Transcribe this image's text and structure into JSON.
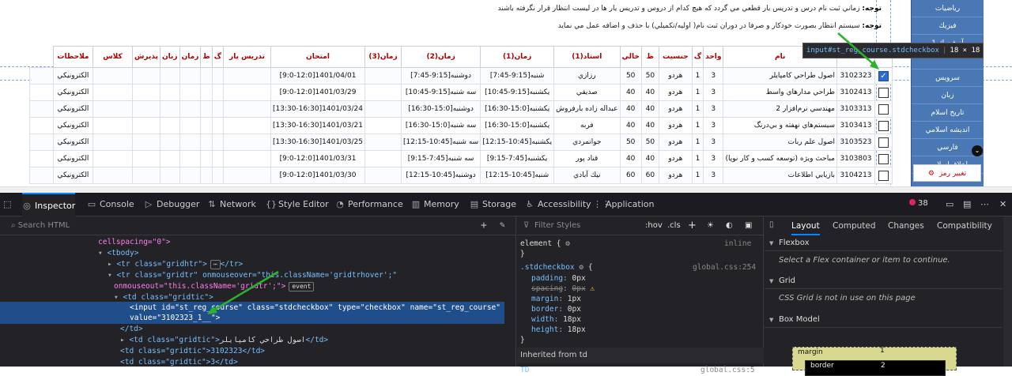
{
  "notes": {
    "note1_label": "توجه:",
    "note1_text": "زماني ثبت نام درس و تدريس يار قطعي مي گردد كه هيچ كدام از دروس و تدريس يار ها در ليست انتظار قرار نگرفته باشند",
    "note2_label": "توجه:",
    "note2_text": "سيستم انتظار بصورت خودكار و صرفا در دوران ثبت نام( اوليه/تكميلي) با حذف و اضافه عمل مي نمايد"
  },
  "sidebar": {
    "items": [
      "رياضيات",
      "فيزيك",
      "آز فيزيك 1",
      "",
      "سرويس",
      "زبان",
      "تاريخ اسلام",
      "انديشه اسلامي",
      "فارسي",
      "اخلاق اسلامي"
    ],
    "password_label": "تغيير رمز",
    "colors": {
      "bg": "#4a78b4"
    }
  },
  "tooltip": {
    "tag": "input",
    "selector": "#st_reg_course.stdcheckbox",
    "dims": "18 × 18"
  },
  "table": {
    "headers": [
      "",
      "كد",
      "نام",
      "واحد",
      "گ",
      "جنسيت",
      "ظ",
      "خالي",
      "استاد(1)",
      "زمان(1)",
      "زمان(2)",
      "زمان(3)",
      "امتحان",
      "تدريس يار",
      "گ",
      "ظ",
      "زمان",
      "زبان",
      "پذيرش",
      "كلاس",
      "ملاحظات"
    ],
    "rows": [
      {
        "code": "3102323",
        "name": "اصول طراحي كامپايلر",
        "unit": "3",
        "group": "1",
        "gender": "هردو",
        "cap": "50",
        "free": "50",
        "prof": "رزازي",
        "t1": "شنبه[9:15-7:45]",
        "t2": "دوشنبه[9:15-7:45]",
        "t3": "",
        "exam": "1401/04/01[9:0-12:0]",
        "cls": "الكترونيكي",
        "checked": true
      },
      {
        "code": "3102413",
        "name": "طراحي مدارهاي واسط",
        "unit": "3",
        "group": "1",
        "gender": "هردو",
        "cap": "40",
        "free": "40",
        "prof": "صديقي",
        "t1": "يكشنبه[9:15-10:45]",
        "t2": "سه شنبه[9:15-10:45]",
        "t3": "",
        "exam": "1401/03/29[9:0-12:0]",
        "cls": "الكترونيكي",
        "checked": false
      },
      {
        "code": "3103313",
        "name": "مهندسي نرم‌افزار 2",
        "unit": "3",
        "group": "1",
        "gender": "هردو",
        "cap": "40",
        "free": "40",
        "prof": "عبداله زاده بارفروش",
        "t1": "يكشنبه[15:0-16:30]",
        "t2": "دوشنبه[15:0-16:30]",
        "t3": "",
        "exam": "1401/03/24[13:30-16:30]",
        "cls": "الكترونيكي",
        "checked": false
      },
      {
        "code": "3103413",
        "name": "سيستم‌هاي نهفته و بي‌درنگ",
        "unit": "3",
        "group": "1",
        "gender": "هردو",
        "cap": "40",
        "free": "40",
        "prof": "فربه",
        "t1": "يكشنبه[15:0-16:30]",
        "t2": "سه شنبه[15:0-16:30]",
        "t3": "",
        "exam": "1401/03/21[13:30-16:30]",
        "cls": "الكترونيكي",
        "checked": false
      },
      {
        "code": "3103523",
        "name": "اصول علم ربات",
        "unit": "3",
        "group": "1",
        "gender": "هردو",
        "cap": "50",
        "free": "50",
        "prof": "جوانمردي",
        "t1": "يكشنبه[10:45-12:15]",
        "t2": "سه شنبه[10:45-12:15]",
        "t3": "",
        "exam": "1401/03/25[13:30-16:30]",
        "cls": "الكترونيكي",
        "checked": false
      },
      {
        "code": "3103803",
        "name": "مباحث ويژه (توسعه كسب و كار نوپا)",
        "unit": "3",
        "group": "1",
        "gender": "هردو",
        "cap": "40",
        "free": "40",
        "prof": "قناد پور",
        "t1": "يكشنبه[7:45-9:15]",
        "t2": "سه شنبه[7:45-9:15]",
        "t3": "",
        "exam": "1401/03/31[9:0-12:0]",
        "cls": "الكترونيكي",
        "checked": false
      },
      {
        "code": "3104213",
        "name": "بازيابي اطلاعات",
        "unit": "3",
        "group": "1",
        "gender": "هردو",
        "cap": "60",
        "free": "60",
        "prof": "نيك آبادي",
        "t1": "شنبه[10:45-12:15]",
        "t2": "دوشنبه[10:45-12:15]",
        "t3": "",
        "exam": "1401/03/30[9:0-12:0]",
        "cls": "الكترونيكي",
        "checked": false
      }
    ]
  },
  "devtools": {
    "tabs": [
      "Inspector",
      "Console",
      "Debugger",
      "Network",
      "Style Editor",
      "Performance",
      "Memory",
      "Storage",
      "Accessibility",
      "Application"
    ],
    "error_count": "38",
    "search_placeholder": "Search HTML",
    "markup": {
      "l1": "cellspacing=\"0\">",
      "l2_tag": "<tbody>",
      "l3_a": "<tr class=\"gridhtr\">",
      "l3_b": "</tr>",
      "l4_a": "<tr class=\"gridtr\" onmouseover=\"this.className='gridtrhover';\"",
      "l5_a": "onmouseout=\"this.className='gridtr';\">",
      "l5_event": "event",
      "l6": "<td class=\"gridtic\">",
      "l7": "<input id=\"st_reg_course\" class=\"stdcheckbox\" type=\"checkbox\" name=\"st_reg_course\"",
      "l8": "value=\"3102323_1__\">",
      "l9": "</td>",
      "l10_a": "<td class=\"gridtic\">",
      "l10_text": "اصول طراحي كامپايلر",
      "l10_b": "</td>",
      "l11": "<td class=\"gridtic\">3102323</td>",
      "l12": "<td class=\"gridtic\">3</td>"
    },
    "styles": {
      "filter_placeholder": "Filter Styles",
      "pseudo": ":hov",
      "cls": ".cls",
      "element_rule": "element {",
      "inline": "inline",
      "close": "}",
      "selector": ".stdcheckbox",
      "source": "global.css:254",
      "props": [
        {
          "name": "padding",
          "value": "0px",
          "struck": false
        },
        {
          "name": "spacing",
          "value": "0px",
          "struck": true
        },
        {
          "name": "margin",
          "value": "1px",
          "struck": false
        },
        {
          "name": "border",
          "value": "0px",
          "struck": false
        },
        {
          "name": "width",
          "value": "18px",
          "struck": false
        },
        {
          "name": "height",
          "value": "18px",
          "struck": false
        }
      ],
      "inherited": "Inherited from td",
      "td_rule": "TD",
      "td_source": "global.css:5"
    },
    "layout": {
      "tabs": [
        "Layout",
        "Computed",
        "Changes",
        "Compatibility"
      ],
      "flexbox_title": "Flexbox",
      "flexbox_msg": "Select a Flex container or item to continue.",
      "grid_title": "Grid",
      "grid_msg": "CSS Grid is not in use on this page",
      "boxmodel_title": "Box Model",
      "margin_label": "margin",
      "margin_value": "1",
      "border_label": "border",
      "border_value": "2"
    }
  }
}
